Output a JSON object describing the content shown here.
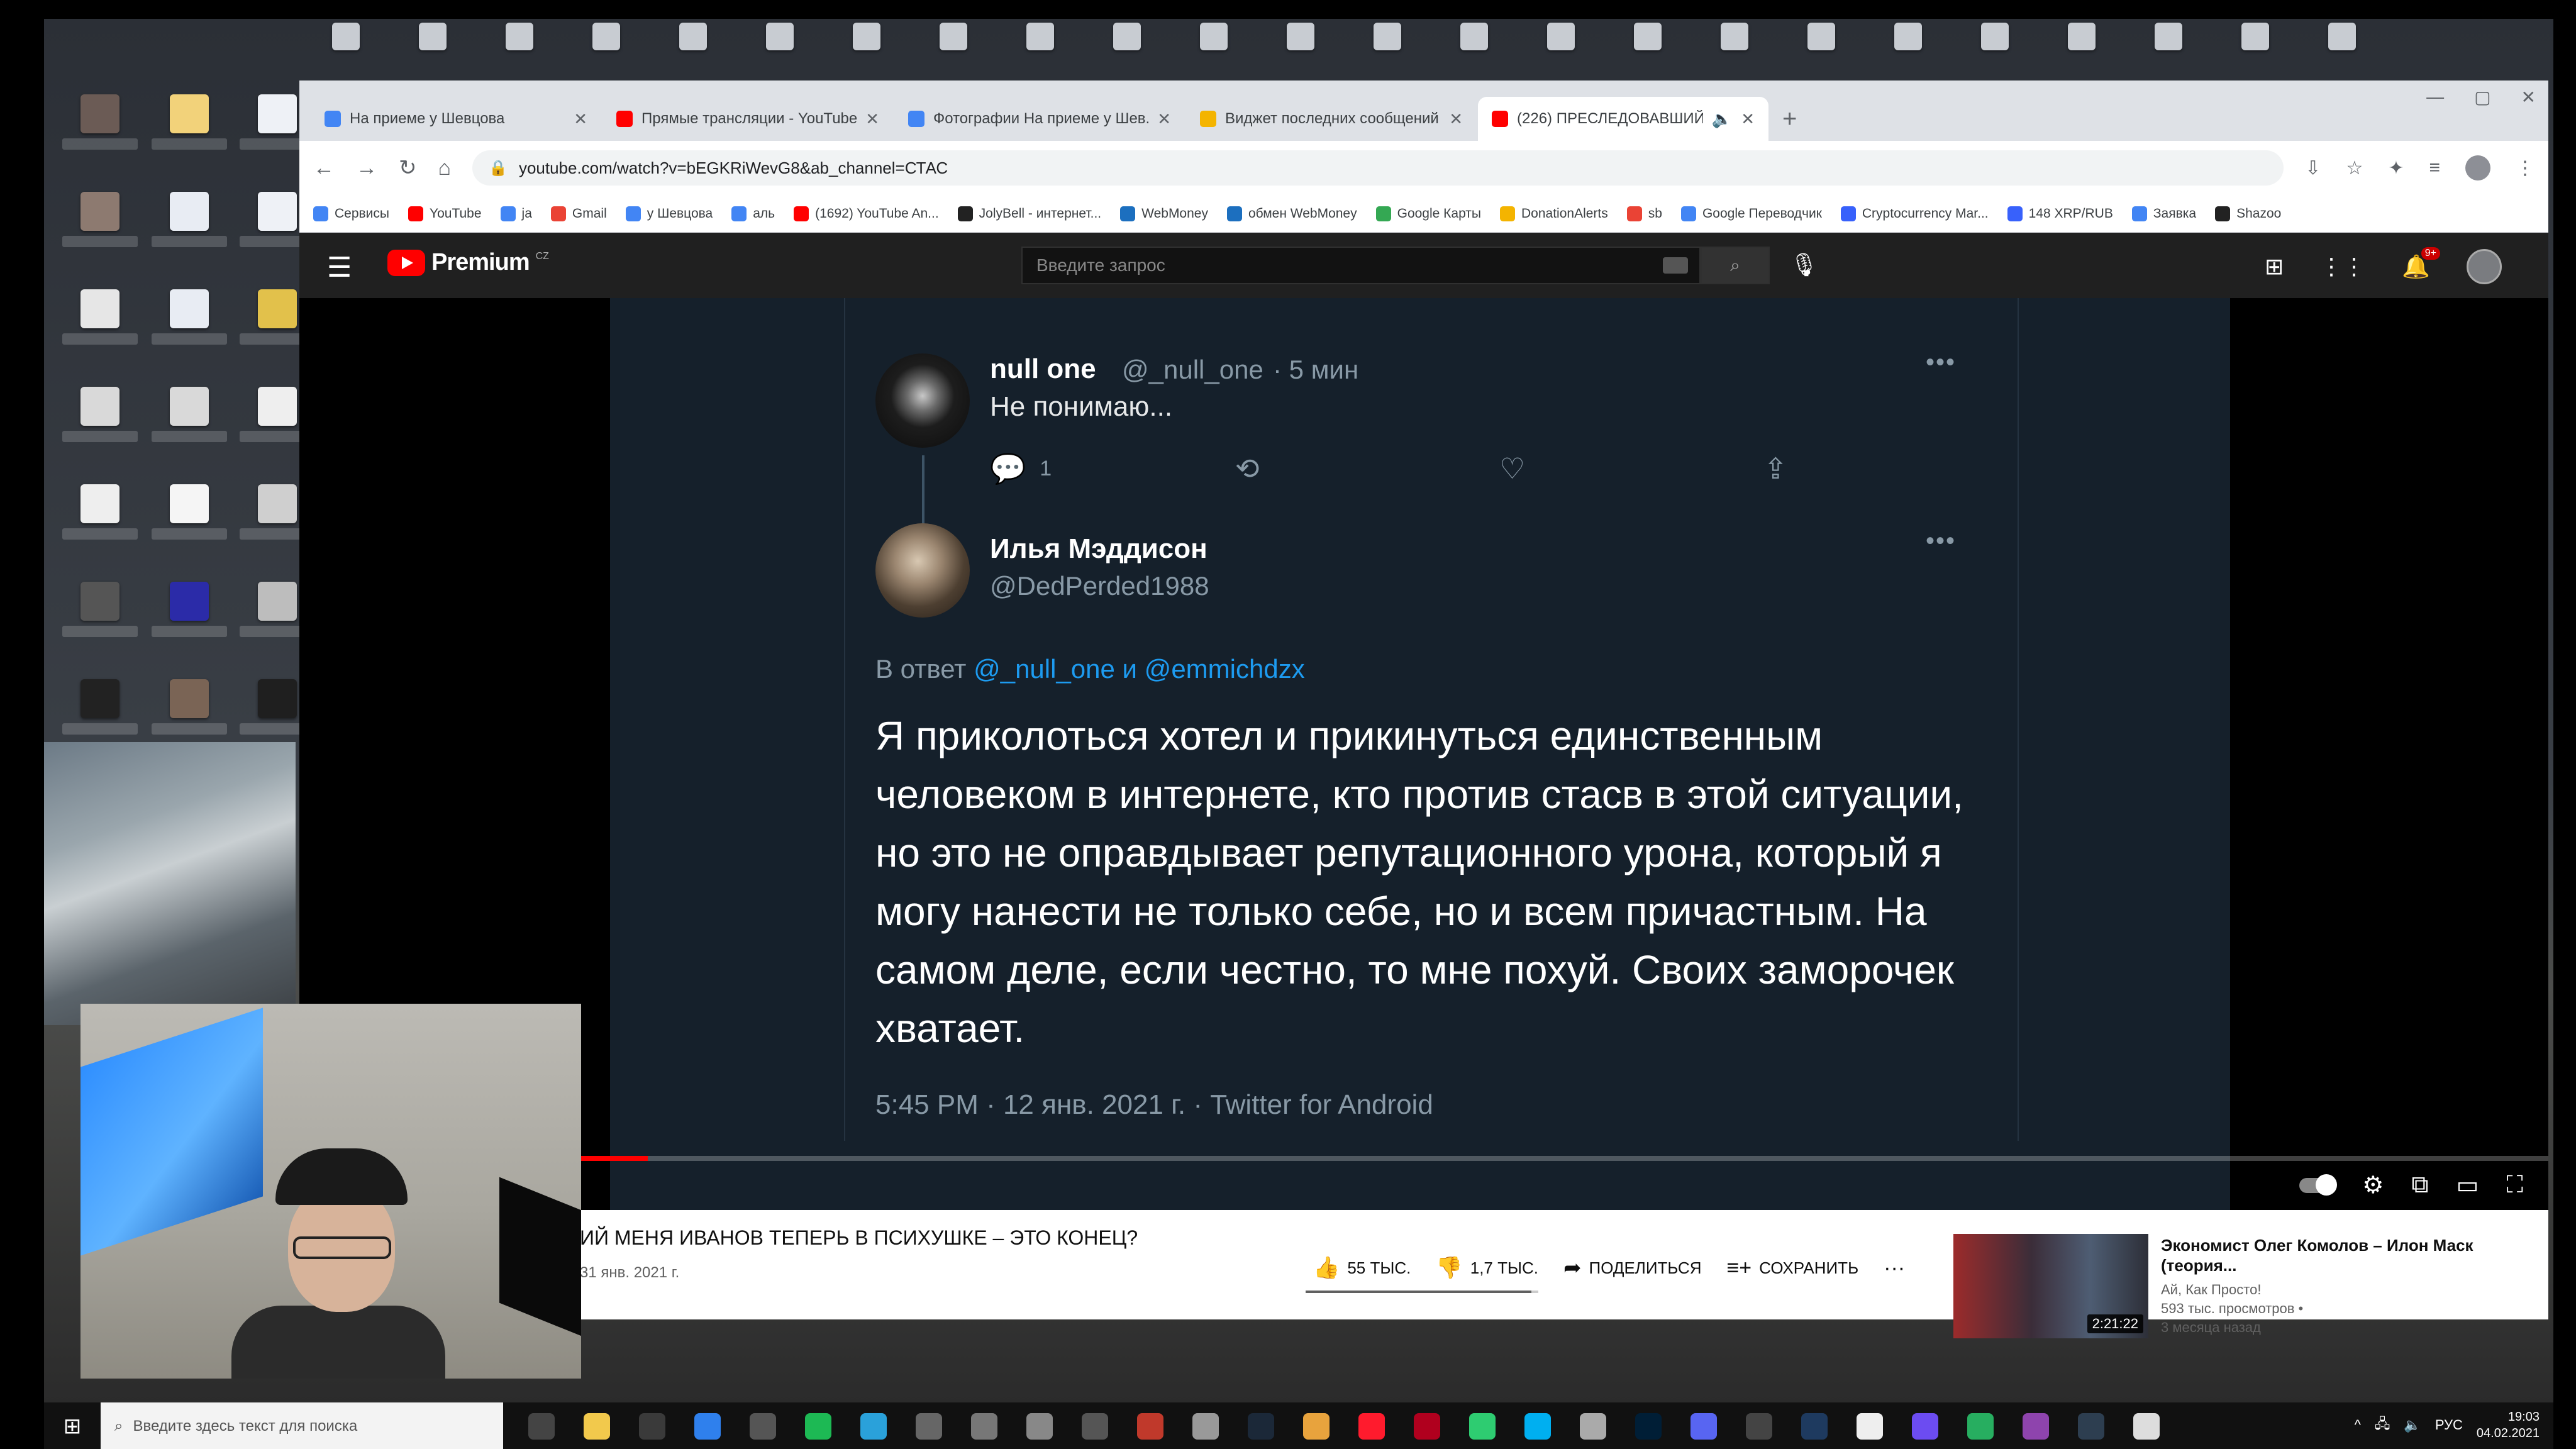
{
  "browser": {
    "tabs": [
      {
        "title": "На приеме у Шевцова",
        "color": "#4285f4",
        "active": false
      },
      {
        "title": "Прямые трансляции - YouTube",
        "color": "#ff0000",
        "active": false
      },
      {
        "title": "Фотографии На приеме у Шев...",
        "color": "#4285f4",
        "active": false
      },
      {
        "title": "Виджет последних сообщений",
        "color": "#f4b400",
        "active": false
      },
      {
        "title": "(226) ПРЕСЛЕДОВАВШИЙ",
        "color": "#ff0000",
        "active": true
      }
    ],
    "url": "youtube.com/watch?v=bEGKRiWevG8&ab_channel=СТАС",
    "bookmarks": [
      {
        "label": "Сервисы",
        "color": "#4285f4"
      },
      {
        "label": "YouTube",
        "color": "#ff0000"
      },
      {
        "label": "ja",
        "color": "#4285f4"
      },
      {
        "label": "Gmail",
        "color": "#ea4335"
      },
      {
        "label": "у Шевцова",
        "color": "#4285f4"
      },
      {
        "label": "аль",
        "color": "#4285f4"
      },
      {
        "label": "(1692) YouTube An...",
        "color": "#ff0000"
      },
      {
        "label": "JolyBell - интернет...",
        "color": "#222222"
      },
      {
        "label": "WebMoney",
        "color": "#1c6fbf"
      },
      {
        "label": "обмен WebMoney",
        "color": "#1c6fbf"
      },
      {
        "label": "Google Карты",
        "color": "#34a853"
      },
      {
        "label": "DonationAlerts",
        "color": "#f4b400"
      },
      {
        "label": "sb",
        "color": "#ea4335"
      },
      {
        "label": "Google Переводчик",
        "color": "#4285f4"
      },
      {
        "label": "Cryptocurrency Mar...",
        "color": "#3861fb"
      },
      {
        "label": "148 XRP/RUB",
        "color": "#3861fb"
      },
      {
        "label": "Заявка",
        "color": "#4285f4"
      },
      {
        "label": "Shazoo",
        "color": "#222222"
      }
    ]
  },
  "youtube": {
    "logo_text": "Premium",
    "region": "CZ",
    "search_placeholder": "Введите запрос",
    "notifications_badge": "9+"
  },
  "tweet1": {
    "name": "null one",
    "handle": "@_null_one",
    "time": "· 5 мин",
    "text": "Не понимаю...",
    "reply_count": "1"
  },
  "tweet2": {
    "name": "Илья Мэддисон",
    "handle": "@DedPerded1988",
    "reply_prefix": "В ответ",
    "reply_mentions": "@_null_one и @emmichdzx",
    "body": "Я приколоться хотел и прикинуться единственным человеком в интернете, кто против стасв в этой ситуации, но это не оправдывает репутационного урона, который я могу нанести не только себе, но и всем причастным. На самом деле, если честно, то мне похуй. Своих заморочек хватает.",
    "meta": "5:45 PM · 12 янв. 2021 г. · Twitter for Android"
  },
  "player": {
    "progress_fraction": 0.155
  },
  "video": {
    "title": "ИЙ МЕНЯ ИВАНОВ ТЕПЕРЬ В ПСИХУШКЕ – ЭТО КОНЕЦ?",
    "date": "31 янв. 2021 г.",
    "likes": "55 ТЫС.",
    "dislikes": "1,7 ТЫС.",
    "share": "ПОДЕЛИТЬСЯ",
    "save": "СОХРАНИТЬ",
    "like_ratio": 0.97
  },
  "recommendation": {
    "title": "Экономист Олег Комолов – Илон Маск (теория...",
    "channel": "Ай, Как Просто!",
    "views": "593 тыс. просмотров •",
    "age": "3 месяца назад",
    "duration": "2:21:22"
  },
  "taskbar": {
    "search_placeholder": "Введите здесь текст для поиска",
    "lang": "РУС",
    "time": "19:03",
    "date": "04.02.2021"
  }
}
